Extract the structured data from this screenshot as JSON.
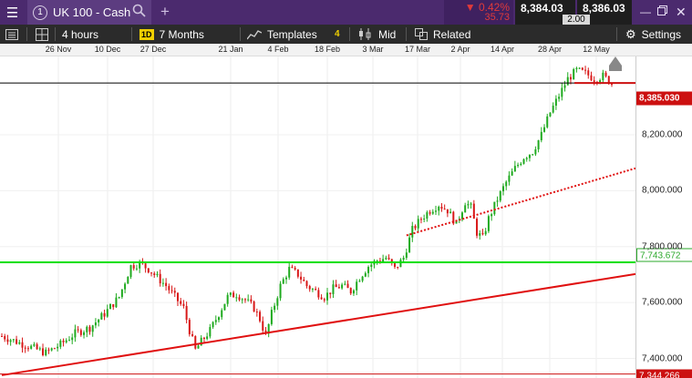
{
  "topbar": {
    "menu_icon": "hamburger-icon",
    "tab_number": "1",
    "instrument": "UK 100 - Cash",
    "search_icon": "search-icon",
    "add_icon": "plus-icon",
    "change_pct": "0.42%",
    "change_pts": "35.73",
    "change_arrow": "▼",
    "sell_price": "8,384.03",
    "buy_price": "8,386.03",
    "spread": "2.00",
    "colors": {
      "bar": "#4b2a6e",
      "down": "#e03a3a"
    }
  },
  "toolbar": {
    "list_icon": "list-icon",
    "layout_icon": "grid-layout-icon",
    "interval": "4 hours",
    "period_badge": "1D",
    "period": "7 Months",
    "templates": "Templates",
    "indicator_count": "4",
    "price_mode": "Mid",
    "related": "Related",
    "settings": "Settings"
  },
  "date_axis": [
    "26 Nov",
    "10 Dec",
    "27 Dec",
    "21 Jan",
    "4 Feb",
    "18 Feb",
    "3 Mar",
    "17 Mar",
    "2 Apr",
    "14 Apr",
    "28 Apr",
    "12 May"
  ],
  "price_axis": {
    "ticks": [
      "8,200.000",
      "8,000.000",
      "7,800.000",
      "7,600.000",
      "7,400.000"
    ],
    "current_tag": "8,385.030",
    "green_tag": "7,743.672",
    "low_tag": "7,344.266"
  },
  "chart_data": {
    "type": "candlestick",
    "instrument": "UK 100 - Cash",
    "interval": "4 hours",
    "period": "7 Months",
    "x_dates": [
      "26 Nov",
      "10 Dec",
      "27 Dec",
      "21 Jan",
      "4 Feb",
      "18 Feb",
      "3 Mar",
      "17 Mar",
      "2 Apr",
      "14 Apr",
      "28 Apr",
      "12 May"
    ],
    "y_ticks": [
      7400,
      7600,
      7800,
      8000,
      8200
    ],
    "ylim": [
      7330,
      8480
    ],
    "close_path": [
      [
        0,
        7480
      ],
      [
        5,
        7460
      ],
      [
        10,
        7440
      ],
      [
        15,
        7420
      ],
      [
        20,
        7450
      ],
      [
        25,
        7490
      ],
      [
        30,
        7510
      ],
      [
        35,
        7560
      ],
      [
        40,
        7620
      ],
      [
        44,
        7730
      ],
      [
        47,
        7740
      ],
      [
        50,
        7720
      ],
      [
        53,
        7690
      ],
      [
        56,
        7660
      ],
      [
        59,
        7620
      ],
      [
        62,
        7580
      ],
      [
        64,
        7500
      ],
      [
        66,
        7430
      ],
      [
        68,
        7460
      ],
      [
        71,
        7500
      ],
      [
        74,
        7560
      ],
      [
        77,
        7620
      ],
      [
        80,
        7630
      ],
      [
        83,
        7610
      ],
      [
        86,
        7580
      ],
      [
        88,
        7540
      ],
      [
        90,
        7480
      ],
      [
        92,
        7560
      ],
      [
        95,
        7660
      ],
      [
        98,
        7720
      ],
      [
        101,
        7700
      ],
      [
        104,
        7660
      ],
      [
        107,
        7640
      ],
      [
        110,
        7620
      ],
      [
        113,
        7650
      ],
      [
        116,
        7660
      ],
      [
        119,
        7640
      ],
      [
        122,
        7690
      ],
      [
        125,
        7730
      ],
      [
        128,
        7750
      ],
      [
        131,
        7760
      ],
      [
        134,
        7720
      ],
      [
        137,
        7760
      ],
      [
        140,
        7860
      ],
      [
        143,
        7900
      ],
      [
        146,
        7930
      ],
      [
        149,
        7950
      ],
      [
        152,
        7930
      ],
      [
        155,
        7880
      ],
      [
        158,
        7960
      ],
      [
        160,
        7940
      ],
      [
        162,
        7850
      ],
      [
        164,
        7830
      ],
      [
        166,
        7900
      ],
      [
        169,
        7970
      ],
      [
        172,
        8030
      ],
      [
        175,
        8080
      ],
      [
        178,
        8120
      ],
      [
        181,
        8140
      ],
      [
        184,
        8200
      ],
      [
        187,
        8280
      ],
      [
        190,
        8340
      ],
      [
        193,
        8400
      ],
      [
        196,
        8430
      ],
      [
        199,
        8420
      ],
      [
        202,
        8400
      ],
      [
        205,
        8410
      ],
      [
        208,
        8385
      ]
    ],
    "horizontal_lines": [
      {
        "price": 8385.03,
        "color": "#000000"
      },
      {
        "price": 7743.672,
        "color": "#00e000"
      },
      {
        "price": 7344.266,
        "color": "#cc1010"
      }
    ],
    "trend_lines": [
      {
        "from": [
          0,
          7340
        ],
        "to": [
          208,
          7702
        ],
        "color": "#e01010",
        "style": "solid"
      },
      {
        "from": [
          138,
          7840
        ],
        "to": [
          208,
          8080
        ],
        "color": "#e01010",
        "style": "dotted"
      }
    ]
  }
}
